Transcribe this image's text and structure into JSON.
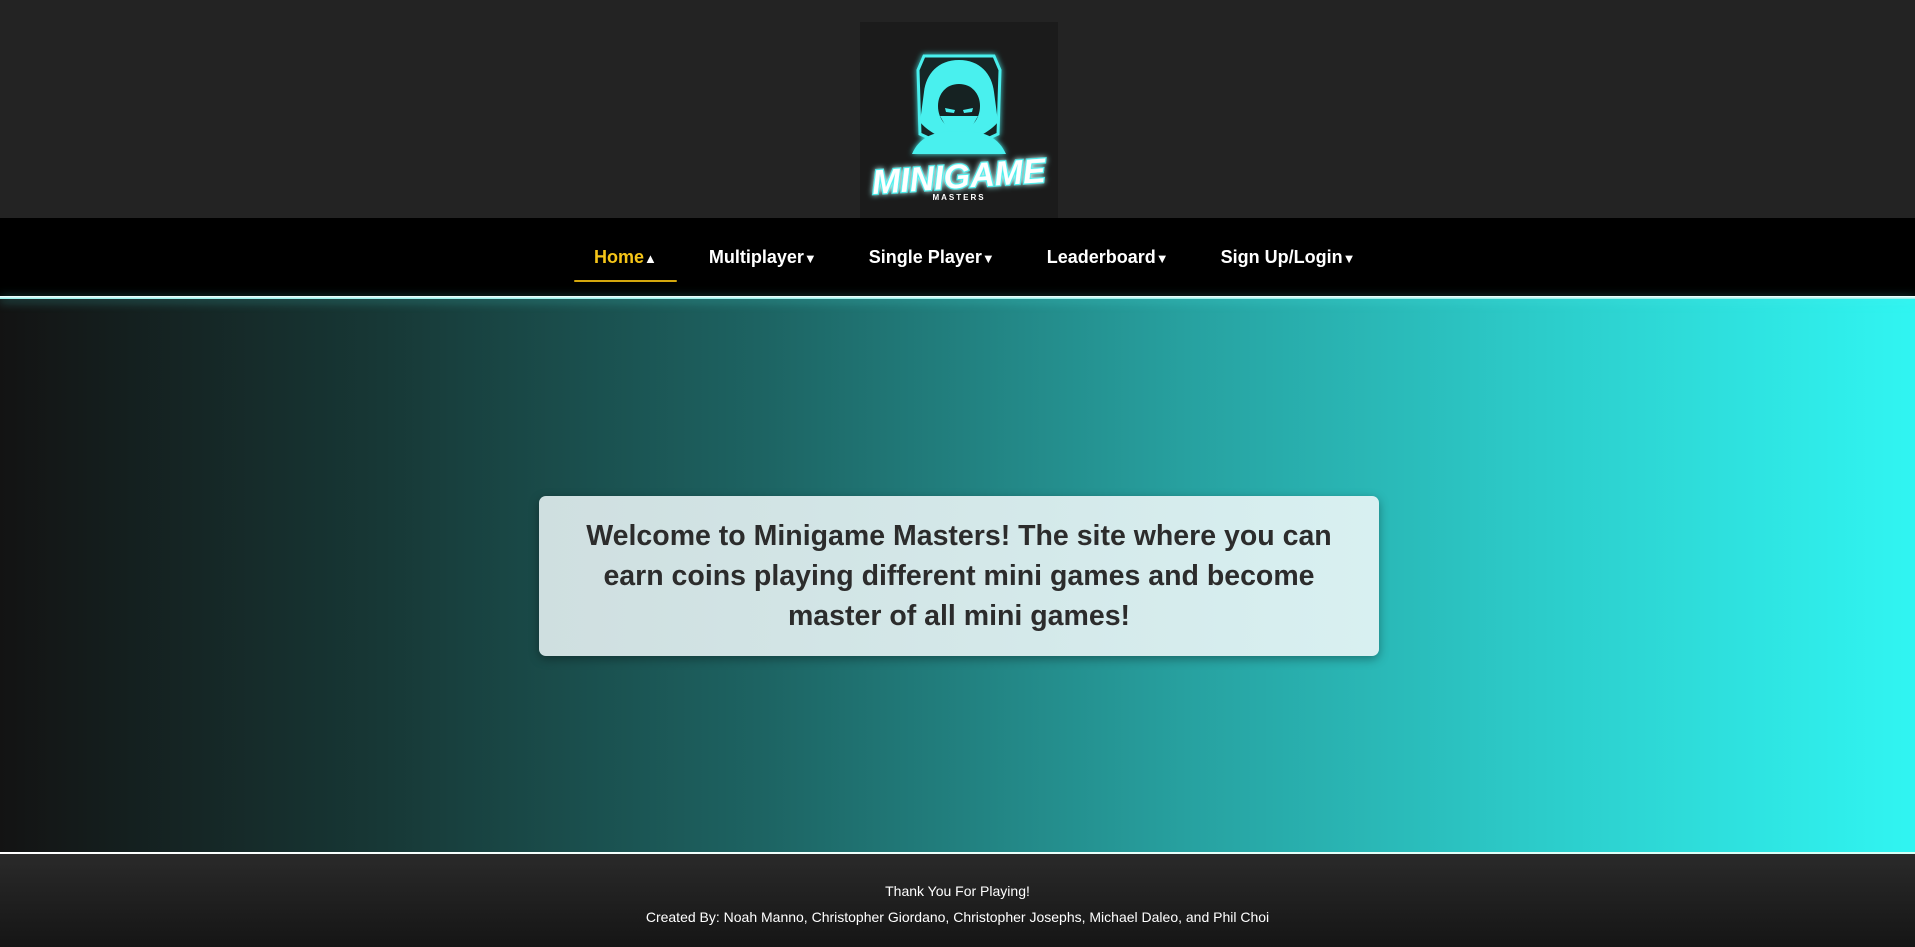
{
  "header": {
    "logo": {
      "title": "MINIGAME",
      "subtitle": "MASTERS",
      "color": "#48f0ee"
    }
  },
  "nav": {
    "items": [
      {
        "label": "Home",
        "arrow": "▲",
        "active": true
      },
      {
        "label": "Multiplayer",
        "arrow": "▼",
        "active": false
      },
      {
        "label": "Single Player",
        "arrow": "▼",
        "active": false
      },
      {
        "label": "Leaderboard",
        "arrow": "▼",
        "active": false
      },
      {
        "label": "Sign Up/Login",
        "arrow": "▼",
        "active": false
      }
    ],
    "active_color": "#f5c518"
  },
  "hero": {
    "welcome": "Welcome to Minigame Masters! The site where you can earn coins playing different mini games and become master of all mini games!"
  },
  "footer": {
    "thanks": "Thank You For Playing!",
    "credits": "Created By: Noah Manno, Christopher Giordano, Christopher Josephs, Michael Daleo, and Phil Choi"
  }
}
